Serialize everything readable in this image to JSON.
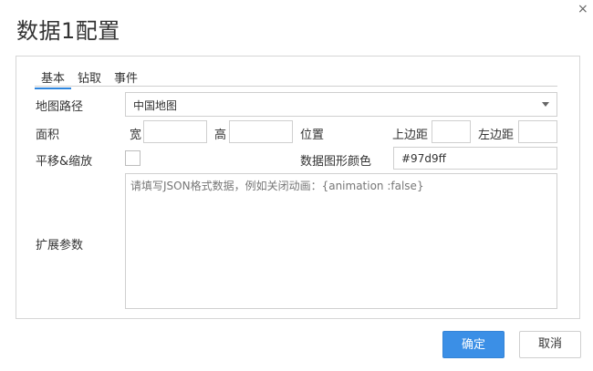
{
  "dialog": {
    "title": "数据1配置",
    "close_symbol": "×"
  },
  "tabs": [
    {
      "label": "基本",
      "active": true
    },
    {
      "label": "钻取",
      "active": false
    },
    {
      "label": "事件",
      "active": false
    }
  ],
  "form": {
    "map_path_label": "地图路径",
    "map_path_value": "中国地图",
    "area_label": "面积",
    "width_label": "宽",
    "height_label": "高",
    "position_label": "位置",
    "top_margin_label": "上边距",
    "left_margin_label": "左边距",
    "pan_zoom_label": "平移&缩放",
    "color_label": "数据图形颜色",
    "color_value": "#97d9ff",
    "ext_params_label": "扩展参数",
    "ext_params_placeholder": "请填写JSON格式数据，例如关闭动画：{animation :false}"
  },
  "buttons": {
    "confirm": "确定",
    "cancel": "取消"
  },
  "colors": {
    "primary": "#3b8fe6",
    "tab_underline": "#2e86de"
  }
}
